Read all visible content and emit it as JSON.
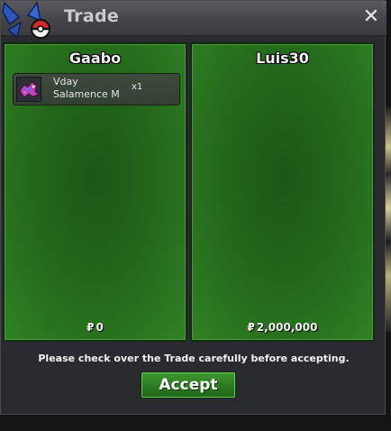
{
  "window": {
    "title": "Trade",
    "close_label": "✕"
  },
  "left_panel": {
    "player_name": "Gaabo",
    "items": [
      {
        "name": "Vday\nSalamence M",
        "quantity": "x1",
        "icon": "salamence-sprite-icon"
      }
    ],
    "currency_symbol": "₽",
    "money": "0"
  },
  "right_panel": {
    "player_name": "Luis30",
    "items": [],
    "currency_symbol": "₽",
    "money": "2,000,000"
  },
  "notice": "Please check over the Trade carefully before accepting.",
  "accept_label": "Accept",
  "colors": {
    "panel_green": "#23661b",
    "button_green": "#2a7a1f",
    "window_bg": "#2a2b2e",
    "titlebar": "#4a4c51"
  }
}
